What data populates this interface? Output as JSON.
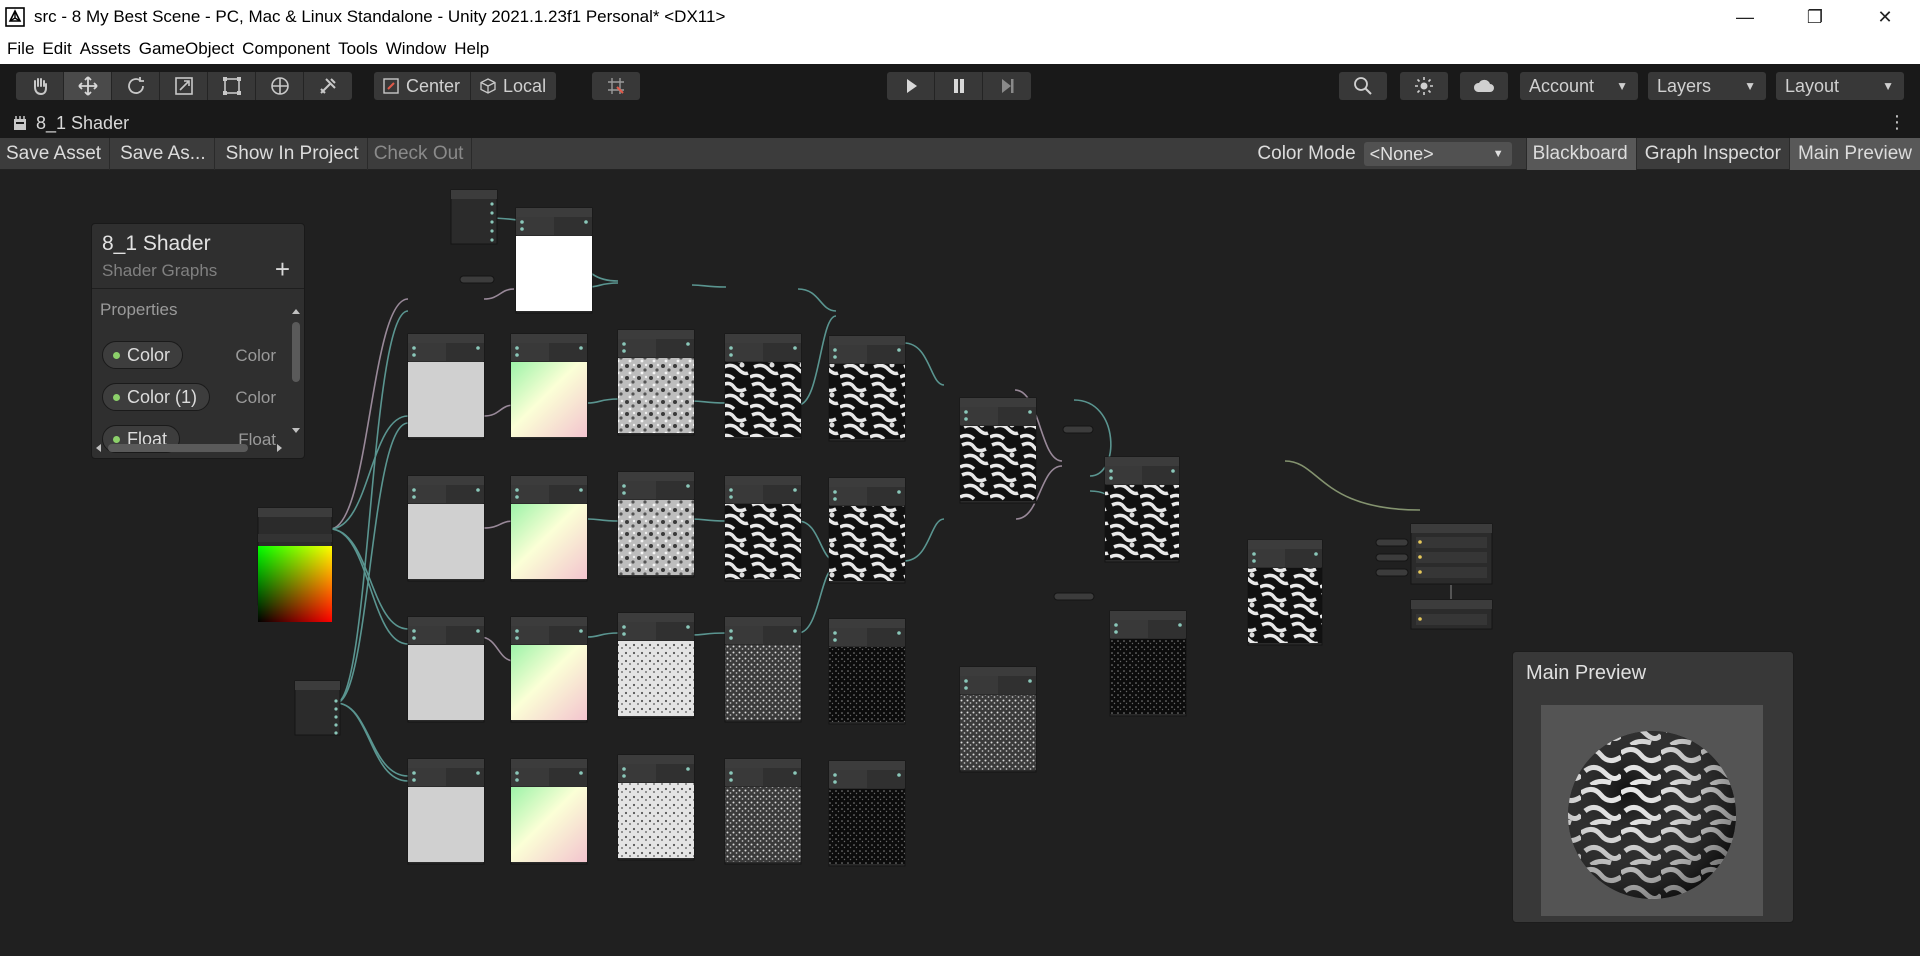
{
  "window": {
    "title": "src - 8 My Best Scene - PC, Mac & Linux Standalone - Unity 2021.1.23f1 Personal* <DX11>",
    "minimize_glyph": "—",
    "restore_glyph": "❐",
    "close_glyph": "✕"
  },
  "menu": [
    "File",
    "Edit",
    "Assets",
    "GameObject",
    "Component",
    "Tools",
    "Window",
    "Help"
  ],
  "toolbar": {
    "pivot_label": "Center",
    "space_label": "Local",
    "account_label": "Account",
    "layers_label": "Layers",
    "layout_label": "Layout"
  },
  "tab": {
    "label": "8_1 Shader"
  },
  "graph_toolbar": {
    "save_asset": "Save Asset",
    "save_as": "Save As...",
    "show_in_project": "Show In Project",
    "check_out": "Check Out",
    "color_mode_label": "Color Mode",
    "color_mode_value": "<None>",
    "blackboard": "Blackboard",
    "graph_inspector": "Graph Inspector",
    "main_preview": "Main Preview"
  },
  "blackboard": {
    "title": "8_1 Shader",
    "subtitle": "Shader Graphs",
    "section": "Properties",
    "properties": [
      {
        "name": "Color",
        "type": "Color"
      },
      {
        "name": "Color (1)",
        "type": "Color"
      },
      {
        "name": "Float",
        "type": "Float"
      }
    ]
  },
  "main_preview": {
    "title": "Main Preview"
  },
  "colors": {
    "accent_port": "#8ac7b9",
    "edge": "#5e9c97",
    "property_dot": "#8cd06a"
  }
}
